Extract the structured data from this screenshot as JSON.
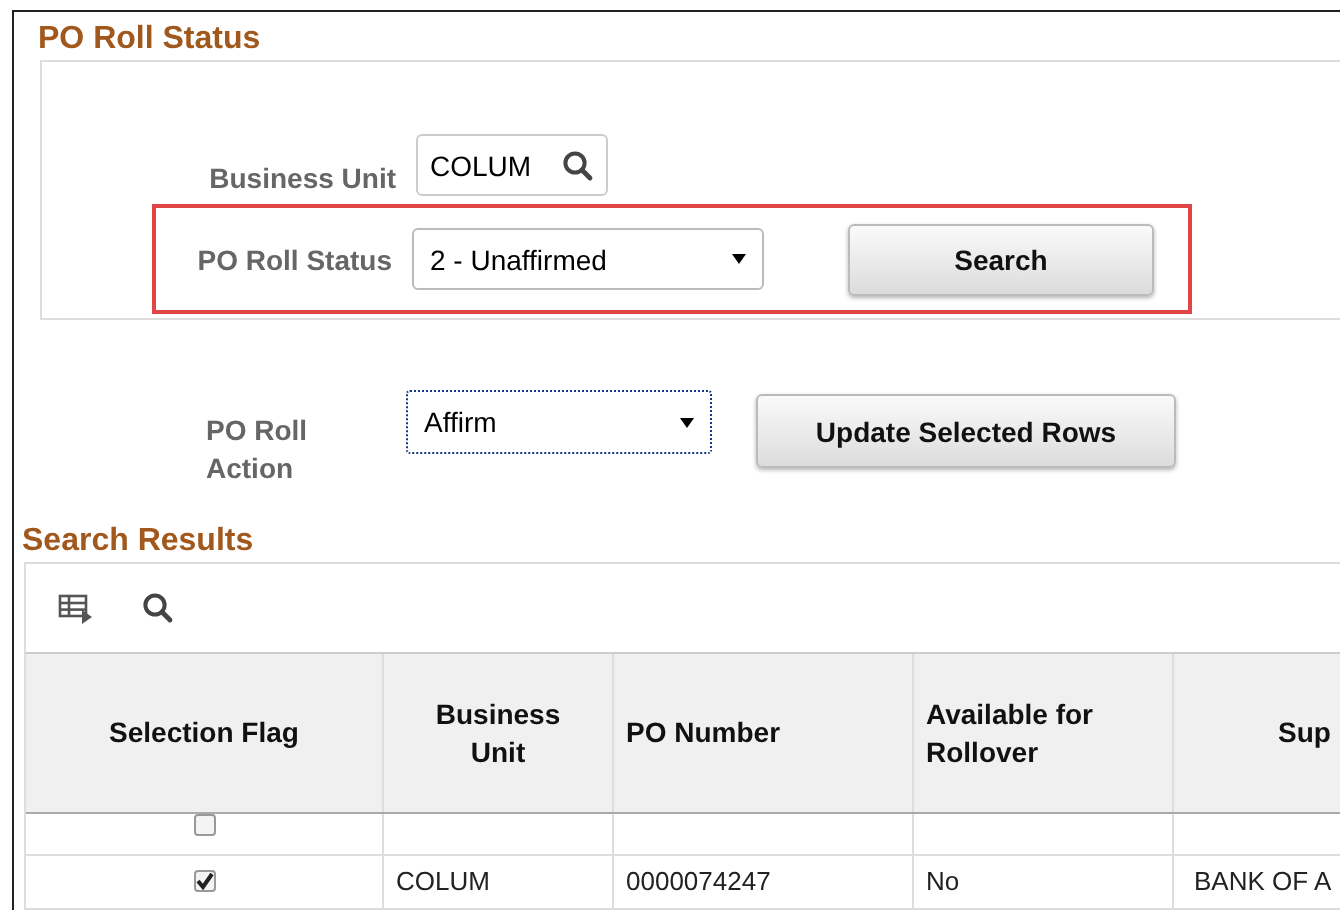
{
  "criteria": {
    "title": "PO Roll Status",
    "business_unit": {
      "label": "Business Unit",
      "value": "COLUM"
    },
    "roll_status": {
      "label": "PO Roll Status",
      "value": "2 - Unaffirmed",
      "highlighted": true
    },
    "search_button": "Search"
  },
  "action": {
    "label_lines": [
      "PO Roll",
      "Action"
    ],
    "value": "Affirm",
    "focused": true,
    "button": "Update Selected Rows"
  },
  "results": {
    "title": "Search Results",
    "columns": [
      "Selection Flag",
      "Business Unit",
      "PO Number",
      "Available for Rollover",
      "Sup"
    ],
    "rows": [
      {
        "checked": false,
        "cells": []
      },
      {
        "checked": true,
        "cells": [
          "",
          "COLUM",
          "0000074247",
          "No",
          "BANK OF A"
        ]
      }
    ]
  }
}
